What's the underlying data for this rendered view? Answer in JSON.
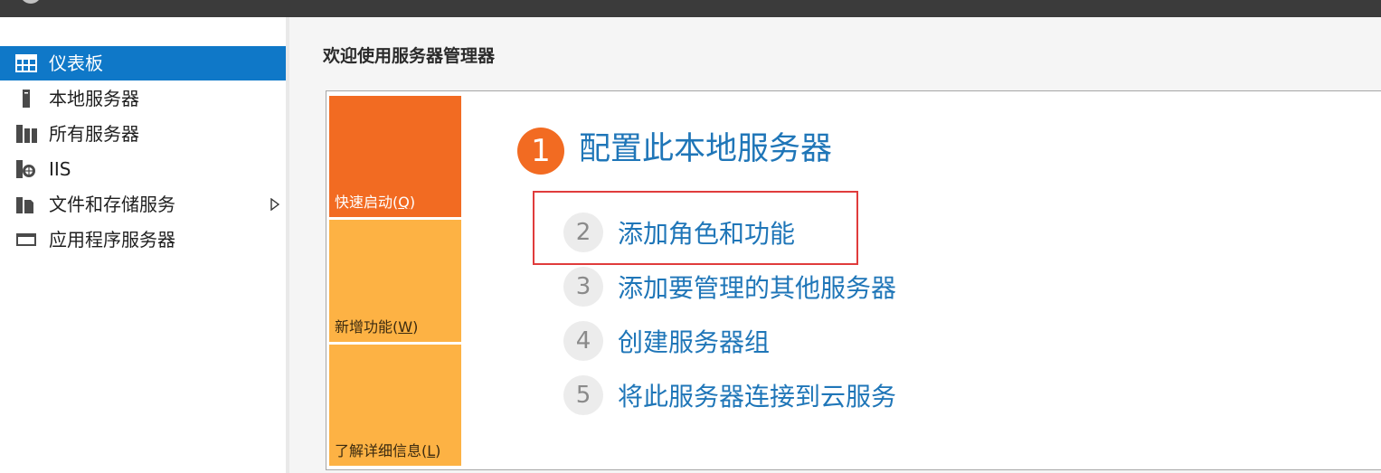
{
  "sidebar": {
    "items": [
      {
        "label": "仪表板",
        "icon": "dashboard-icon",
        "active": true
      },
      {
        "label": "本地服务器",
        "icon": "local-server-icon"
      },
      {
        "label": "所有服务器",
        "icon": "all-servers-icon"
      },
      {
        "label": "IIS",
        "icon": "iis-icon"
      },
      {
        "label": "文件和存储服务",
        "icon": "file-storage-icon",
        "has_submenu": true
      },
      {
        "label": "应用程序服务器",
        "icon": "app-server-icon"
      }
    ]
  },
  "main": {
    "welcome_title": "欢迎使用服务器管理器",
    "tiles": {
      "quick_start": {
        "text": "快速启动(",
        "key": "Q",
        "end": ")"
      },
      "new_features": {
        "text": "新增功能(",
        "key": "W",
        "end": ")"
      },
      "learn_more": {
        "text": "了解详细信息(",
        "key": "L",
        "end": ")"
      }
    },
    "step1": {
      "number": "1",
      "label": "配置此本地服务器"
    },
    "steps": [
      {
        "number": "2",
        "label": "添加角色和功能"
      },
      {
        "number": "3",
        "label": "添加要管理的其他服务器"
      },
      {
        "number": "4",
        "label": "创建服务器组"
      },
      {
        "number": "5",
        "label": "将此服务器连接到云服务"
      }
    ]
  },
  "colors": {
    "accent_blue": "#0f78c8",
    "link_blue": "#1f76b8",
    "orange": "#f26b22",
    "amber": "#fdb244",
    "highlight_red": "#e03c3c"
  }
}
